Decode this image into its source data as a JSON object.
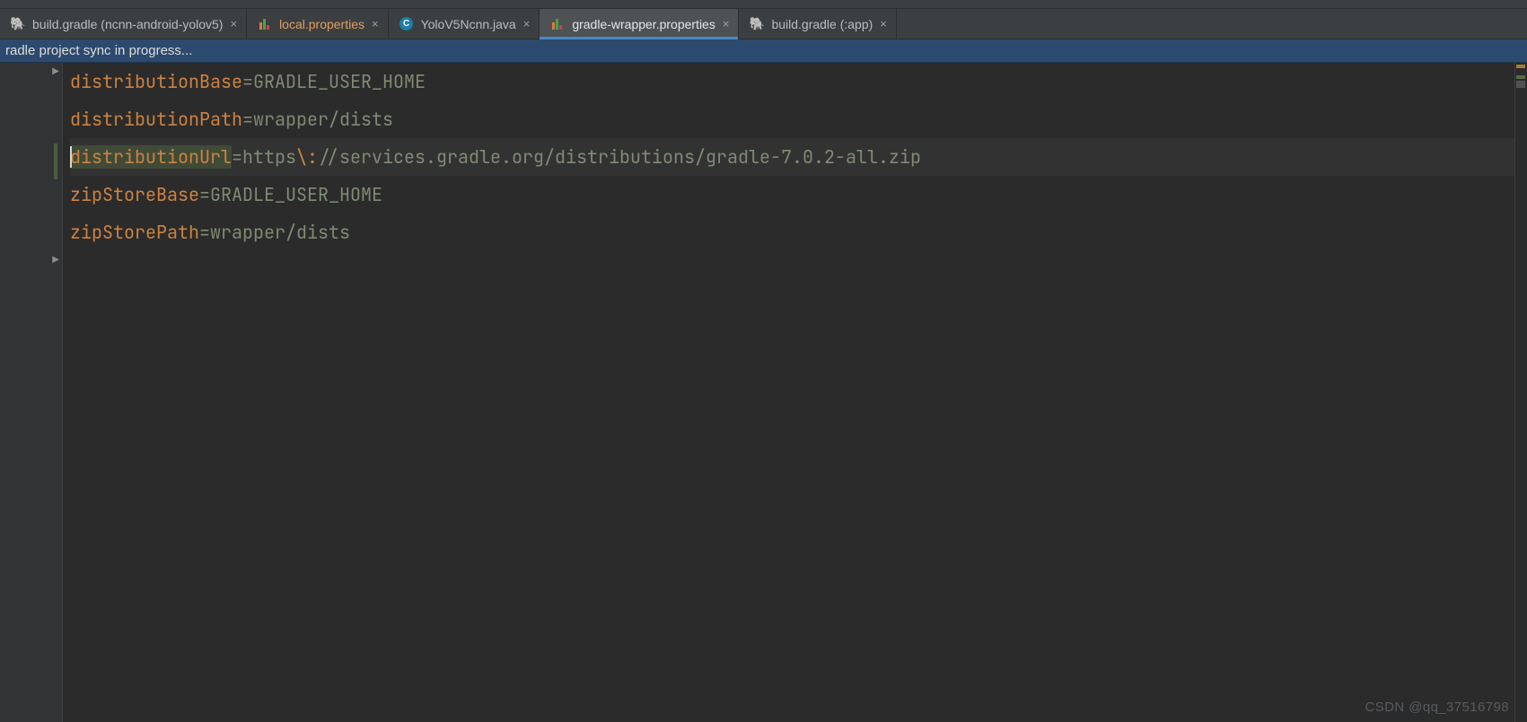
{
  "tabs": [
    {
      "label": "build.gradle (ncnn-android-yolov5)",
      "icon": "elephant",
      "modified": false,
      "active": false
    },
    {
      "label": "local.properties",
      "icon": "bars",
      "modified": true,
      "active": false
    },
    {
      "label": "YoloV5Ncnn.java",
      "icon": "circle-c",
      "modified": false,
      "active": false
    },
    {
      "label": "gradle-wrapper.properties",
      "icon": "bars",
      "modified": false,
      "active": true
    },
    {
      "label": "build.gradle (:app)",
      "icon": "elephant",
      "modified": false,
      "active": false
    }
  ],
  "status": {
    "message": "radle project sync in progress..."
  },
  "code": {
    "lines": [
      {
        "key": "distributionBase",
        "value": "GRADLE_USER_HOME",
        "highlight": false,
        "current": false
      },
      {
        "key": "distributionPath",
        "value": "wrapper/dists",
        "highlight": false,
        "current": false
      },
      {
        "key": "distributionUrl",
        "value_pre": "https",
        "value_esc": "\\:",
        "value_post": "//services.gradle.org/distributions/gradle-7.0.2-all.zip",
        "highlight": true,
        "current": true
      },
      {
        "key": "zipStoreBase",
        "value": "GRADLE_USER_HOME",
        "highlight": false,
        "current": false
      },
      {
        "key": "zipStorePath",
        "value": "wrapper/dists",
        "highlight": false,
        "current": false
      }
    ]
  },
  "watermark": "CSDN @qq_37516798",
  "close_glyph": "×"
}
